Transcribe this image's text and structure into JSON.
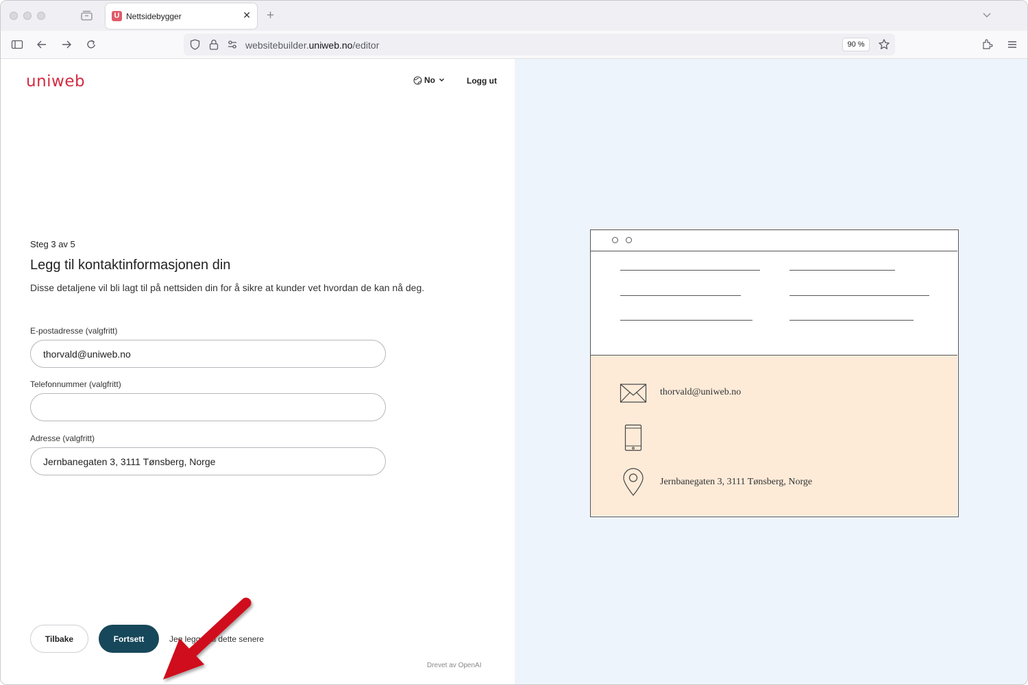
{
  "browser": {
    "tab_title": "Nettsidebygger",
    "tab_favicon_letter": "U",
    "url_prefix": "websitebuilder.",
    "url_domain": "uniweb.no",
    "url_path": "/editor",
    "zoom": "90 %"
  },
  "header": {
    "logo": "uniweb",
    "language": "No",
    "logout": "Logg ut"
  },
  "form": {
    "step": "Steg 3 av 5",
    "title": "Legg til kontaktinformasjonen din",
    "description": "Disse detaljene vil bli lagt til på nettsiden din for å sikre at kunder vet hvordan de kan nå deg.",
    "email_label": "E-postadresse (valgfritt)",
    "email_value": "thorvald@uniweb.no",
    "phone_label": "Telefonnummer (valgfritt)",
    "phone_value": "",
    "address_label": "Adresse (valgfritt)",
    "address_value": "Jernbanegaten 3, 3111 Tønsberg, Norge"
  },
  "footer": {
    "back": "Tilbake",
    "continue": "Fortsett",
    "skip": "Jeg legger til dette senere",
    "powered_by": "Drevet av OpenAI"
  },
  "preview": {
    "email": "thorvald@uniweb.no",
    "phone": "",
    "address": "Jernbanegaten 3, 3111 Tønsberg, Norge"
  },
  "colors": {
    "brand": "#d42a40",
    "primary_button": "#17475a",
    "preview_background": "#eef4fb",
    "contact_background": "#fdebd8",
    "annotation_arrow": "#d0101e"
  }
}
